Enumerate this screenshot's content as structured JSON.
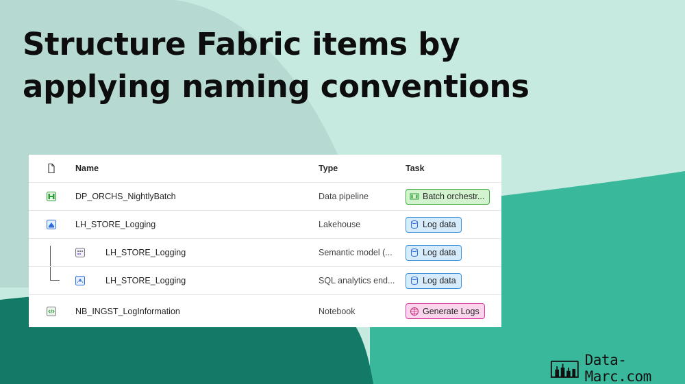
{
  "headline": {
    "line1": "Structure Fabric items by",
    "line2": "applying naming conventions"
  },
  "table": {
    "columns": {
      "icon": "file-icon",
      "name": "Name",
      "type": "Type",
      "task": "Task"
    },
    "rows": [
      {
        "name": "DP_ORCHS_NightlyBatch",
        "type": "Data pipeline",
        "task": "Batch orchestr...",
        "task_color": "green",
        "icon": "pipeline-icon",
        "child": false
      },
      {
        "name": "LH_STORE_Logging",
        "type": "Lakehouse",
        "task": "Log data",
        "task_color": "blue",
        "icon": "lakehouse-icon",
        "child": false
      },
      {
        "name": "LH_STORE_Logging",
        "type": "Semantic model (...",
        "task": "Log data",
        "task_color": "blue",
        "icon": "semantic-model-icon",
        "child": true
      },
      {
        "name": "LH_STORE_Logging",
        "type": "SQL analytics end...",
        "task": "Log data",
        "task_color": "blue",
        "icon": "sql-endpoint-icon",
        "child": true
      },
      {
        "name": "NB_INGST_LogInformation",
        "type": "Notebook",
        "task": "Generate Logs",
        "task_color": "pink",
        "icon": "notebook-icon",
        "child": false
      }
    ]
  },
  "brand": {
    "name": "Data-Marc.com"
  },
  "colors": {
    "bg_light": "#c6e9e0",
    "bg_mid": "#b6dad2",
    "bg_teal": "#3ab89b",
    "bg_dark": "#127a66"
  }
}
